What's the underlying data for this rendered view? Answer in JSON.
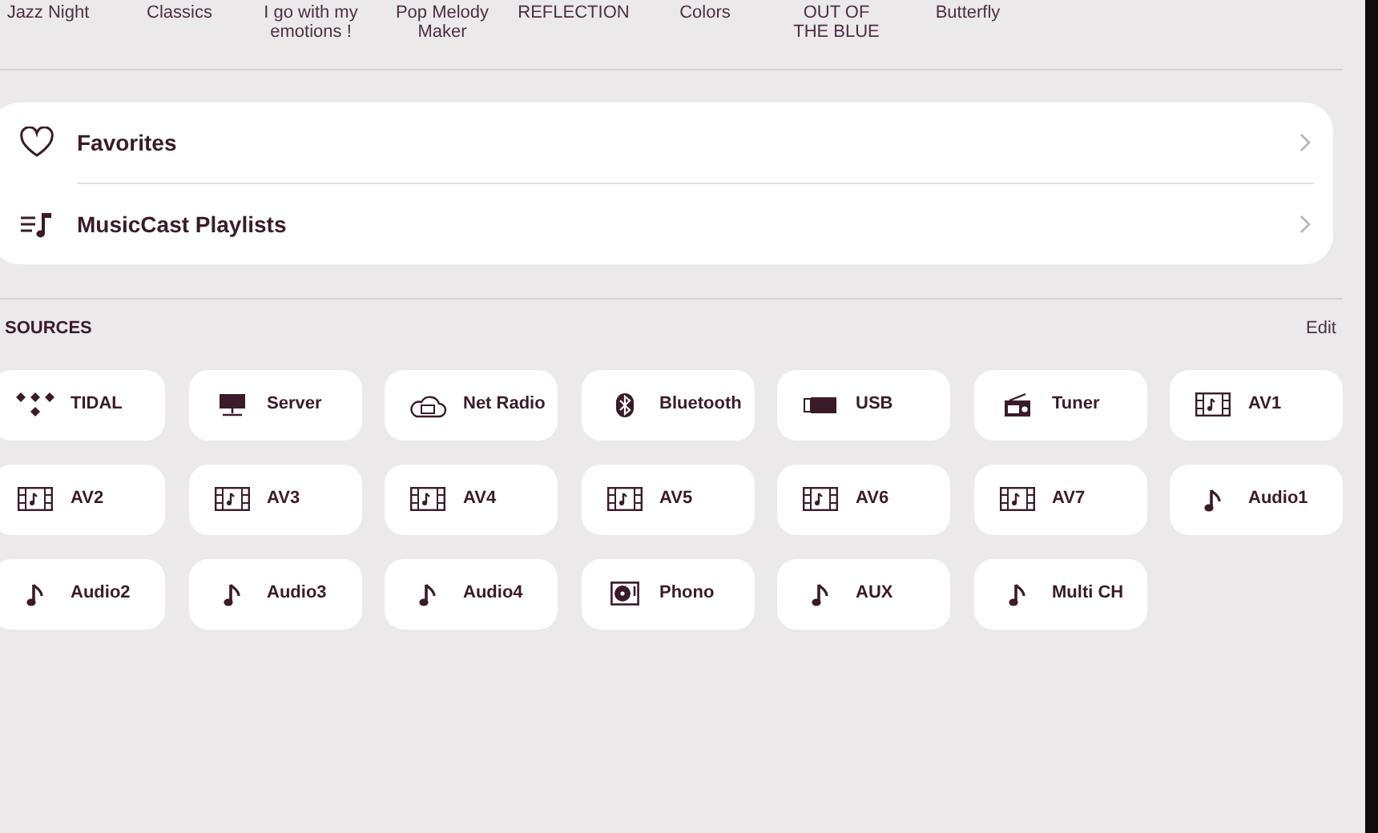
{
  "albums": [
    {
      "lines": [
        "Jazz Night"
      ]
    },
    {
      "lines": [
        "Classics"
      ]
    },
    {
      "lines": [
        "I go with my",
        "emotions !"
      ]
    },
    {
      "lines": [
        "Pop Melody",
        "Maker"
      ]
    },
    {
      "lines": [
        "REFLECTION"
      ]
    },
    {
      "lines": [
        "Colors"
      ]
    },
    {
      "lines": [
        "OUT OF",
        "THE BLUE"
      ]
    },
    {
      "lines": [
        "Butterfly"
      ]
    }
  ],
  "menu": [
    {
      "kind": "favorites",
      "label": "Favorites"
    },
    {
      "kind": "playlists",
      "label": "MusicCast Playlists"
    }
  ],
  "sources": {
    "title": "SOURCES",
    "edit": "Edit",
    "items": [
      {
        "kind": "tidal",
        "label": "TIDAL"
      },
      {
        "kind": "server",
        "label": "Server"
      },
      {
        "kind": "net_radio",
        "label": "Net Radio"
      },
      {
        "kind": "bluetooth",
        "label": "Bluetooth"
      },
      {
        "kind": "usb",
        "label": "USB"
      },
      {
        "kind": "tuner",
        "label": "Tuner"
      },
      {
        "kind": "av",
        "label": "AV1"
      },
      {
        "kind": "av",
        "label": "AV2"
      },
      {
        "kind": "av",
        "label": "AV3"
      },
      {
        "kind": "av",
        "label": "AV4"
      },
      {
        "kind": "av",
        "label": "AV5"
      },
      {
        "kind": "av",
        "label": "AV6"
      },
      {
        "kind": "av",
        "label": "AV7"
      },
      {
        "kind": "audio",
        "label": "Audio1"
      },
      {
        "kind": "audio",
        "label": "Audio2"
      },
      {
        "kind": "audio",
        "label": "Audio3"
      },
      {
        "kind": "audio",
        "label": "Audio4"
      },
      {
        "kind": "phono",
        "label": "Phono"
      },
      {
        "kind": "audio",
        "label": "AUX"
      },
      {
        "kind": "audio",
        "label": "Multi CH"
      }
    ]
  }
}
